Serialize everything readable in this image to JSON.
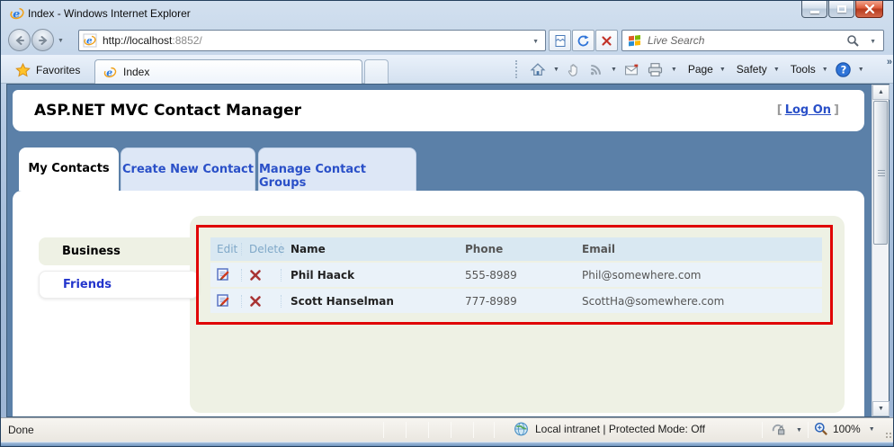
{
  "window": {
    "title": "Index - Windows Internet Explorer",
    "address": {
      "host": "http://localhost",
      "rest": ":8852/"
    },
    "search": {
      "placeholder": "Live Search"
    },
    "favorites_label": "Favorites",
    "tab_label": "Index",
    "menu": {
      "page": "Page",
      "safety": "Safety",
      "tools": "Tools"
    },
    "status": {
      "done": "Done",
      "zone": "Local intranet | Protected Mode: Off",
      "zoom_level": "100%"
    },
    "glyphs": {
      "dropdown": "▼",
      "overflow": "»",
      "scroll_up": "▲",
      "scroll_down": "▼"
    }
  },
  "page": {
    "title": "ASP.NET MVC Contact Manager",
    "logon": {
      "open": "[",
      "label": "Log On",
      "close": "]"
    },
    "tabs": [
      {
        "label": "My Contacts"
      },
      {
        "label": "Create New Contact"
      },
      {
        "label": "Manage Contact Groups"
      }
    ],
    "groups": [
      {
        "label": "Business"
      },
      {
        "label": "Friends"
      }
    ],
    "contacts_table": {
      "headers": {
        "edit": "Edit",
        "delete": "Delete",
        "name": "Name",
        "phone": "Phone",
        "email": "Email"
      },
      "rows": [
        {
          "name": "Phil Haack",
          "phone": "555-8989",
          "email": "Phil@somewhere.com"
        },
        {
          "name": "Scott Hanselman",
          "phone": "777-8989",
          "email": "ScottHa@somewhere.com"
        }
      ]
    }
  },
  "colors": {
    "page_background": "#5b80a8",
    "highlight_border": "#e00505",
    "tab_link_blue": "#2a50c8",
    "panel_green": "#eef1e4",
    "table_header_bg": "#d9e8f2",
    "table_row_bg": "#eaf2f9"
  }
}
